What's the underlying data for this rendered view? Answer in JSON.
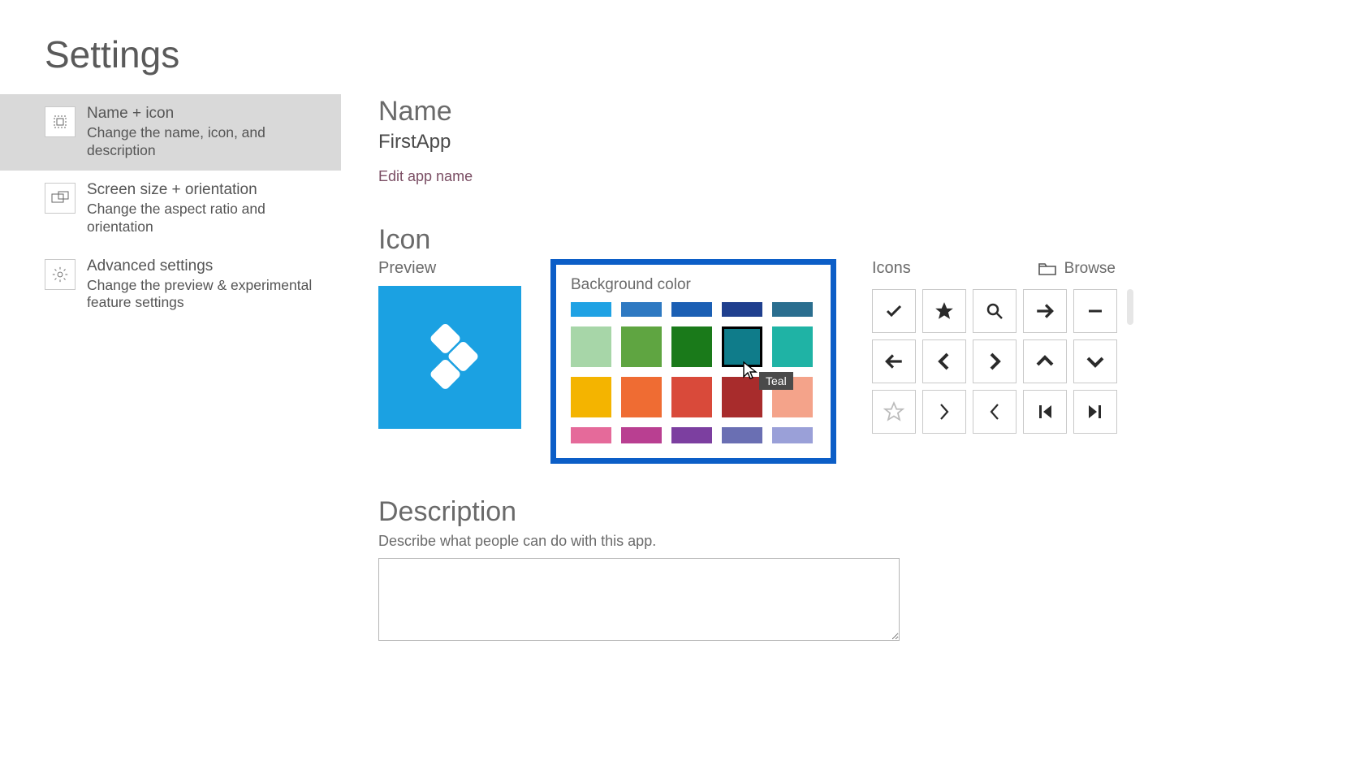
{
  "page_title": "Settings",
  "sidebar": {
    "items": [
      {
        "title": "Name + icon",
        "desc": "Change the name, icon, and description"
      },
      {
        "title": "Screen size + orientation",
        "desc": "Change the aspect ratio and orientation"
      },
      {
        "title": "Advanced settings",
        "desc": "Change the preview & experimental feature settings"
      }
    ]
  },
  "name": {
    "heading": "Name",
    "value": "FirstApp",
    "edit_link": "Edit app name"
  },
  "icon": {
    "heading": "Icon",
    "preview_label": "Preview",
    "preview_bg": "#1ba1e2",
    "bg_label": "Background color",
    "tooltip": "Teal",
    "swatches": [
      [
        "#1fa2e4",
        "#2e79c2",
        "#1b5fb4",
        "#1f3f8e",
        "#2a6e8f"
      ],
      [
        "#a7d6a8",
        "#5fa541",
        "#1a7a1a",
        "#0f7c8a",
        "#1fb3a5"
      ],
      [
        "#f4b400",
        "#ef6c33",
        "#d94a3a",
        "#a82c2c",
        "#f4a38a"
      ],
      [
        "#e56a9a",
        "#b93f91",
        "#7c3fa0",
        "#6a6fb3",
        "#9aa0d8"
      ]
    ],
    "icons_label": "Icons",
    "browse_label": "Browse",
    "glyphs": [
      "check",
      "star-filled",
      "search",
      "arrow-right",
      "minus",
      "arrow-left",
      "chevron-left",
      "chevron-right",
      "chevron-up",
      "chevron-down",
      "star-outline",
      "angle-right",
      "angle-left",
      "skip-prev",
      "skip-next"
    ]
  },
  "description": {
    "heading": "Description",
    "hint": "Describe what people can do with this app.",
    "value": ""
  }
}
